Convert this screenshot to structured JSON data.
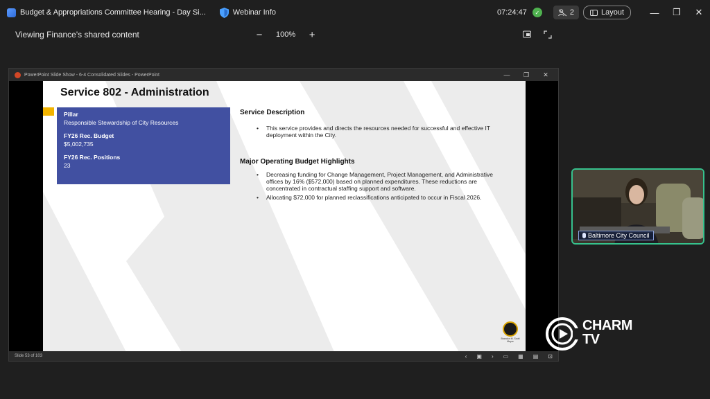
{
  "titlebar": {
    "meeting_title": "Budget & Appropriations Committee Hearing - Day Si...",
    "webinar_info": "Webinar Info",
    "timer": "07:24:47",
    "participant_count": "2",
    "layout_label": "Layout",
    "minimize": "—",
    "restore": "❐",
    "close": "✕"
  },
  "sharebar": {
    "viewing_text": "Viewing Finance's shared content",
    "zoom_out": "−",
    "zoom_level": "100%",
    "zoom_in": "+"
  },
  "ppt_window": {
    "title": "PowerPoint Slide Show  -  6-4 Consolidated Slides - PowerPoint",
    "status": "Slide 53 of 103"
  },
  "slide": {
    "title": "Service 802 - Administration",
    "pillar_label": "Pillar",
    "pillar_value": "Responsible Stewardship of City Resources",
    "budget_label": "FY26 Rec. Budget",
    "budget_value": "$5,002,735",
    "positions_label": "FY26 Rec. Positions",
    "positions_value": "23",
    "service_description_heading": "Service Description",
    "service_description": "This service provides and directs the resources needed for successful and effective IT deployment within the City.",
    "highlights_heading": "Major Operating Budget Highlights",
    "highlights": [
      "Decreasing funding for Change Management, Project Management, and Administrative offices by 16% ($572,000) based on planned expenditures. These reductions are concentrated in contractual staffing support and software.",
      "Allocating $72,000 for planned reclassifications anticipated to occur in Fiscal 2026."
    ],
    "seal_text": "Brandon M. Scott Mayor"
  },
  "video": {
    "label": "Baltimore City Council"
  },
  "logo": {
    "line1": "CHARM",
    "line2": "TV"
  },
  "colors": {
    "info_box": "#4150a1",
    "accent": "#f2b400",
    "video_border": "#36c28d"
  }
}
